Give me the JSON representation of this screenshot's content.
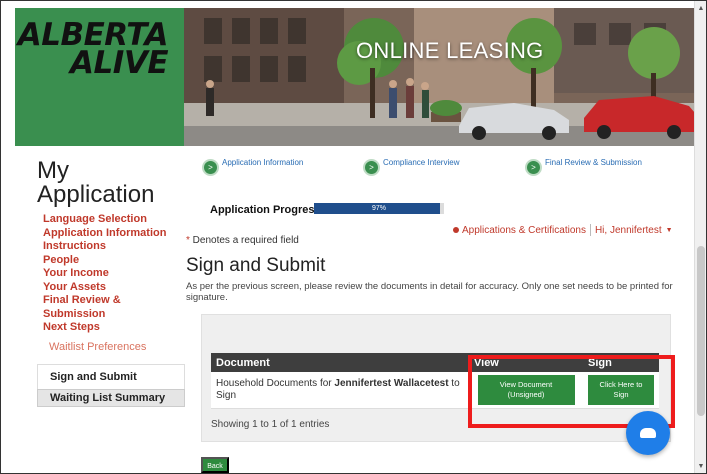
{
  "header": {
    "logo_line1": "ALBERTA",
    "logo_line2": "ALIVE",
    "banner_title": "ONLINE LEASING"
  },
  "sidebar": {
    "title_line1": "My",
    "title_line2": "Application",
    "links": [
      "Language Selection",
      "Application Information",
      "Instructions",
      "People",
      "Your Income",
      "Your Assets",
      "Final Review & Submission",
      "Next Steps"
    ],
    "waitlist_preferences": "Waitlist Preferences",
    "active_item": "Sign and Submit",
    "waiting_list_summary": "Waiting List Summary"
  },
  "steps": [
    {
      "label": "Application Information"
    },
    {
      "label": "Compliance Interview"
    },
    {
      "label": "Final Review & Submission"
    }
  ],
  "progress": {
    "label": "Application Progress",
    "value_text": "97%",
    "value": 97
  },
  "required_note": {
    "star": "*",
    "text": " Denotes a required field"
  },
  "top_links": {
    "apps_link": "Applications & Certifications",
    "user_menu": "Hi, Jennifertest"
  },
  "main": {
    "title": "Sign and Submit",
    "description": "As per the previous screen, please review the documents in detail for accuracy. Only one set needs to be printed for signature."
  },
  "table": {
    "headers": [
      "Document",
      "View",
      "Sign"
    ],
    "row": {
      "doc_prefix": "Household Documents for ",
      "doc_name": "Jennifertest Wallacetest",
      "doc_suffix": " to Sign",
      "view_button_line1": "View Document",
      "view_button_line2": "(Unsigned)",
      "sign_button_line1": "Click Here to",
      "sign_button_line2": "Sign"
    },
    "entries_text": "Showing 1 to 1 of 1 entries"
  },
  "back_button": "Back",
  "colors": {
    "brand_green": "#3a8f4f",
    "button_green": "#2e8b3e",
    "nav_red": "#c0392b",
    "progress_blue": "#1f4e8c",
    "highlight_red": "#ee1c1c",
    "chat_blue": "#1f7ee8"
  }
}
